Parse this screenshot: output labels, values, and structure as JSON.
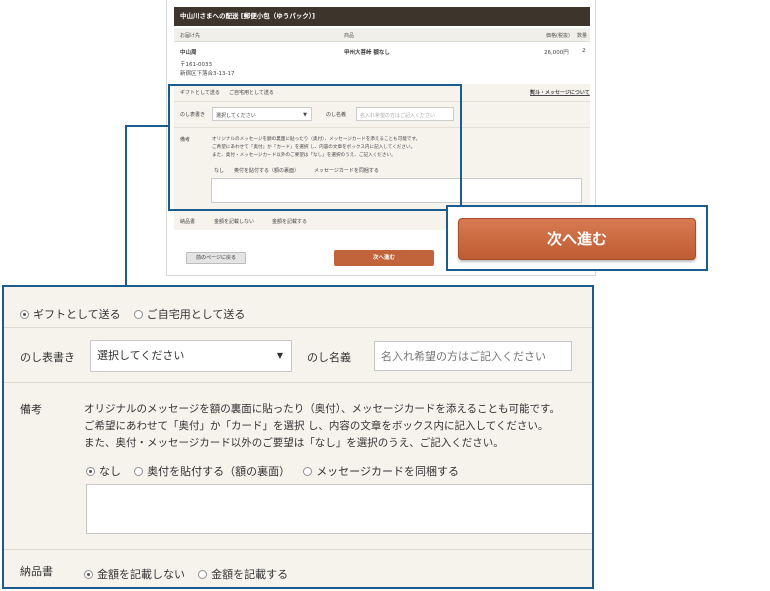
{
  "mini": {
    "header": "中山川さまへの配送 [郵便小包（ゆうパック）]",
    "cols": {
      "recipient": "お届け先",
      "product": "商品",
      "price": "価格(税抜)",
      "qty": "数量"
    },
    "row": {
      "name": "中山周",
      "zip": "〒161-0033",
      "address": "新宿区下落合3-13-17",
      "product": "甲州大菩峠 額なし",
      "price": "26,000円",
      "qty": "2"
    },
    "gift_link": "熨斗・メッセージについて",
    "back_button": "前のページに戻る",
    "next_button": "次へ進む"
  },
  "form": {
    "gift_options": [
      "ギフトとして送る",
      "ご自宅用として送る"
    ],
    "noshi_label": "のし表書き",
    "noshi_select": "選択してください",
    "noshi_name_label": "のし名義",
    "noshi_name_placeholder": "名入れ希望の方はご記入ください",
    "remarks_label": "備考",
    "remarks_text_1": "オリジナルのメッセージを額の裏面に貼ったり（奥付）、メッセージカードを添えることも可能です。",
    "remarks_text_2": "ご希望にあわせて「奥付」か「カード」を選択 し、内容の文章をボックス内に記入してください。",
    "remarks_text_3": "また、奥付・メッセージカード以外のご要望は「なし」を選択のうえ、ご記入ください。",
    "message_options": [
      "なし",
      "奥付を貼付する（額の裏面）",
      "メッセージカードを同梱する"
    ],
    "invoice_label": "納品書",
    "invoice_options": [
      "金額を記載しない",
      "金額を記載する"
    ]
  },
  "zoom_next_button": "次へ進む",
  "colors": {
    "accent": "#1c5c8c",
    "button": "#c1633b",
    "header": "#3d342c",
    "panel": "#f6f3ed"
  }
}
